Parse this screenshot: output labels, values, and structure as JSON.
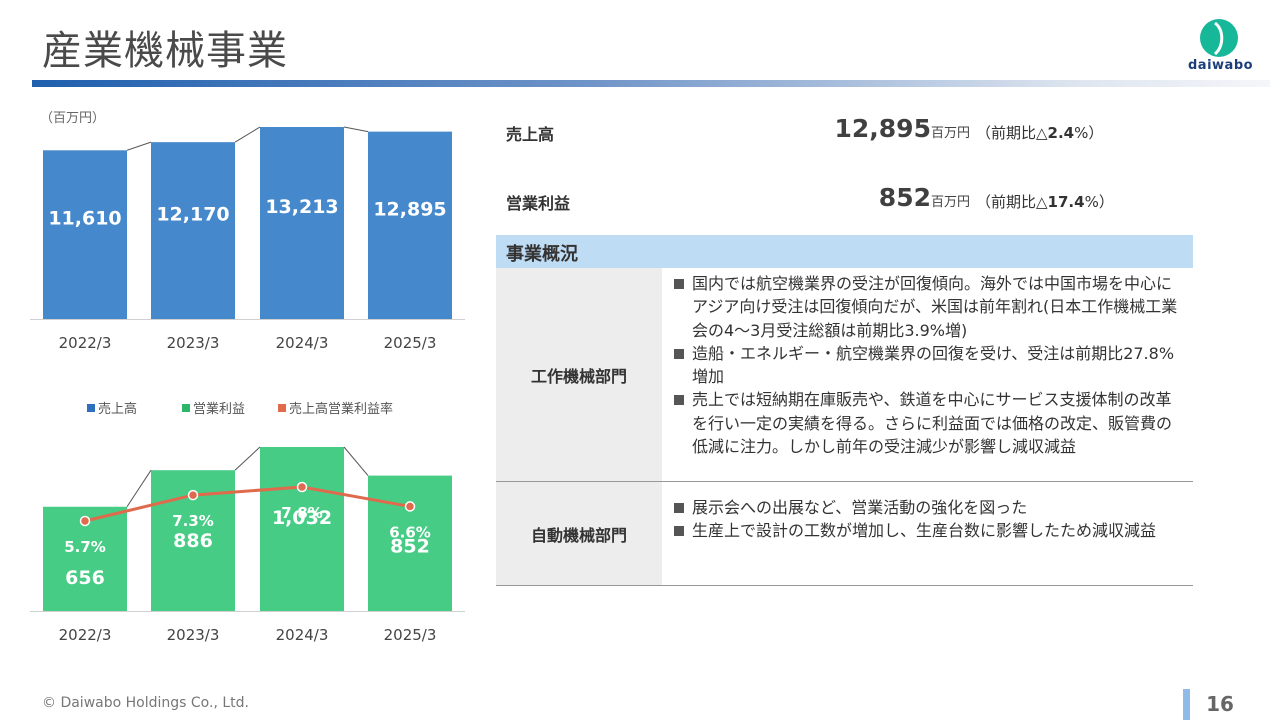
{
  "header": {
    "title": "産業機械事業",
    "logo_text": "daiwabo"
  },
  "colors": {
    "sales": "#4589cc",
    "profit": "#46cc85",
    "rate": "#e06a4c",
    "header_fill": "#bfdcf5"
  },
  "unit_label": "（百万円）",
  "legend": [
    {
      "label": "売上高",
      "color": "#2f6fbf"
    },
    {
      "label": "営業利益",
      "color": "#2db56a"
    },
    {
      "label": "売上高営業利益率",
      "color": "#e06a4c"
    }
  ],
  "chart_data": [
    {
      "type": "bar",
      "categories": [
        "2022/3",
        "2023/3",
        "2024/3",
        "2025/3"
      ],
      "series": [
        {
          "name": "売上高",
          "values": [
            11610,
            12170,
            13213,
            12895
          ]
        }
      ],
      "value_labels": [
        "11,610",
        "12,170",
        "13,213",
        "12,895"
      ],
      "ylim": [
        0,
        13213
      ]
    },
    {
      "type": "bar",
      "categories": [
        "2022/3",
        "2023/3",
        "2024/3",
        "2025/3"
      ],
      "series": [
        {
          "name": "営業利益",
          "values": [
            656,
            886,
            1032,
            852
          ]
        },
        {
          "name": "売上高営業利益率",
          "type": "line",
          "values": [
            5.7,
            7.3,
            7.8,
            6.6
          ]
        }
      ],
      "value_labels": [
        "656",
        "886",
        "1,032",
        "852"
      ],
      "rate_labels": [
        "5.7%",
        "7.3%",
        "7.8%",
        "6.6%"
      ],
      "ylim": [
        0,
        1032
      ]
    }
  ],
  "metrics": [
    {
      "label": "売上高",
      "value": "12,895",
      "unit": "百万円",
      "cmp_prefix": "（前期比△",
      "cmp_value": "2.4",
      "cmp_suffix": "%）"
    },
    {
      "label": "営業利益",
      "value": "852",
      "unit": "百万円",
      "cmp_prefix": "（前期比△",
      "cmp_value": "17.4",
      "cmp_suffix": "%）"
    }
  ],
  "section_header": "事業概況",
  "rows": [
    {
      "label": "工作機械部門",
      "bullets": [
        "国内では航空機業界の受注が回復傾向。海外では中国市場を中心にアジア向け受注は回復傾向だが、米国は前年割れ(日本工作機械工業会の4～3月受注総額は前期比3.9%増)",
        "造船・エネルギー・航空機業界の回復を受け、受注は前期比27.8%増加",
        "売上では短納期在庫販売や、鉄道を中心にサービス支援体制の改革を行い一定の実績を得る。さらに利益面では価格の改定、販管費の低減に注力。しかし前年の受注減少が影響し減収減益"
      ]
    },
    {
      "label": "自動機械部門",
      "bullets": [
        "展示会への出展など、営業活動の強化を図った",
        "生産上で設計の工数が増加し、生産台数に影響したため減収減益"
      ]
    }
  ],
  "footer": {
    "copyright": "© Daiwabo Holdings Co., Ltd.",
    "page": "16"
  }
}
